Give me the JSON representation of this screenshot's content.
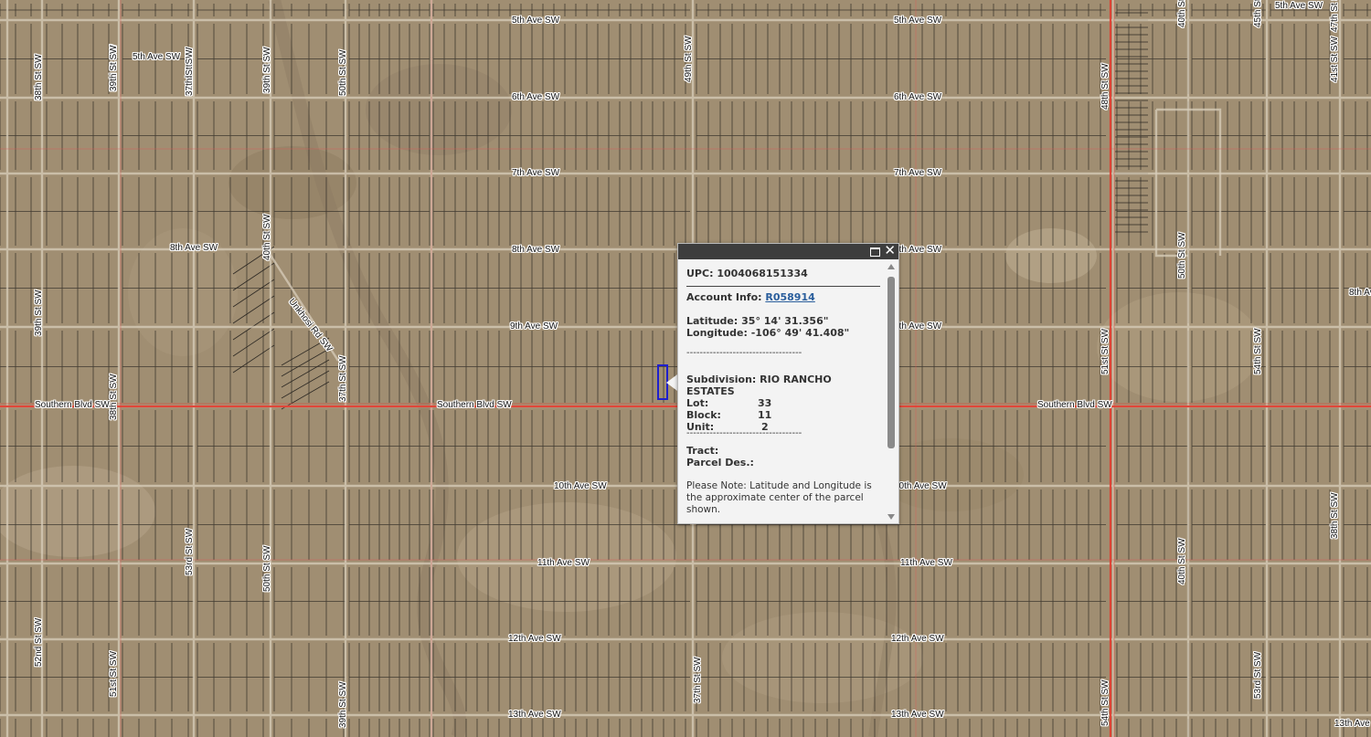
{
  "map": {
    "horizontal_street_labels": [
      "5th Ave SW",
      "5th Ave SW",
      "5th Ave SW",
      "5th Ave SW",
      "6th Ave SW",
      "6th Ave SW",
      "7th Ave SW",
      "7th Ave SW",
      "8th Ave SW",
      "8th Ave SW",
      "8th Ave SW",
      "8th Ave SW",
      "9th Ave SW",
      "9th Ave SW",
      "Southern Blvd SW",
      "Southern Blvd SW",
      "Southern Blvd SW",
      "10th Ave SW",
      "10th Ave SW",
      "11th Ave SW",
      "11th Ave SW",
      "12th Ave SW",
      "12th Ave SW",
      "13th Ave SW",
      "13th Ave SW",
      "13th Ave SW"
    ],
    "vertical_street_labels": [
      "54th St SW",
      "53rd St SW",
      "52nd St SW",
      "51st St SW",
      "50th St SW",
      "49th St SW",
      "48th St SW",
      "47th St SW",
      "45th St SW",
      "41st St SW",
      "40th St SW",
      "39th St SW",
      "38th St SW",
      "37th St SW",
      "51st St SW",
      "54th St SW",
      "53rd St SW",
      "50th St SW",
      "40th St SW",
      "38th St SW",
      "52nd St SW",
      "51st St SW",
      "39th St SW",
      "37th St SW",
      "54th St SW",
      "53rd St SW",
      "50th St SW",
      "47th St SW",
      "40th St SW",
      "38th St SW",
      "39th St SW",
      "37th St SW",
      "39th St SW"
    ],
    "diagonal_street_labels": [
      "Unkhosi Rd SW"
    ]
  },
  "popup": {
    "upc_label": "UPC:",
    "upc_value": "1004068151334",
    "account_label": "Account Info:",
    "account_value": "R058914",
    "latitude_label": "Latitude:",
    "latitude_value": "35° 14' 31.356\"",
    "longitude_label": "Longitude:",
    "longitude_value": "-106° 49' 41.408\"",
    "divider": "-----------------------------------",
    "subdivision_label": "Subdivision:",
    "subdivision_value_line1": "RIO RANCHO",
    "subdivision_value_line2": "ESTATES",
    "lot_label": "Lot:",
    "lot_value": "33",
    "block_label": "Block:",
    "block_value": "11",
    "unit_label": "Unit:",
    "unit_value": "2",
    "tract_label": "Tract:",
    "tract_value": "",
    "parcel_des_label": "Parcel Des.:",
    "parcel_des_value": "",
    "note_line1": "Please Note: Latitude and Longitude is",
    "note_line2": "the approximate center of the parcel",
    "note_line3": "shown.",
    "scroll_position": 0.0
  },
  "colors": {
    "terrain": "#a08e72",
    "parcel_lines": "#2e2a24",
    "roads": "#d8cdbb",
    "section_lines": "#e05a5a",
    "major_road": "#e33b2e",
    "selection": "#1f1fcc",
    "popup_title": "#3d3d3d",
    "link": "#2a5e9c"
  }
}
